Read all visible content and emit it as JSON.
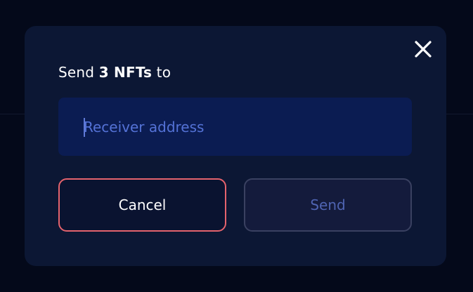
{
  "dialog": {
    "title_prefix": "Send ",
    "title_count": "3 NFTs",
    "title_suffix": " to",
    "close_icon": "close-icon"
  },
  "receiver": {
    "value": "",
    "placeholder": "Receiver address"
  },
  "actions": {
    "cancel_label": "Cancel",
    "send_label": "Send",
    "send_enabled": false
  },
  "colors": {
    "page_background": "#04091a",
    "modal_background": "#0c1734",
    "input_background": "#0b1c52",
    "placeholder": "#5472d6",
    "cancel_border": "#e5636d",
    "send_disabled_text": "#4f64b2"
  }
}
